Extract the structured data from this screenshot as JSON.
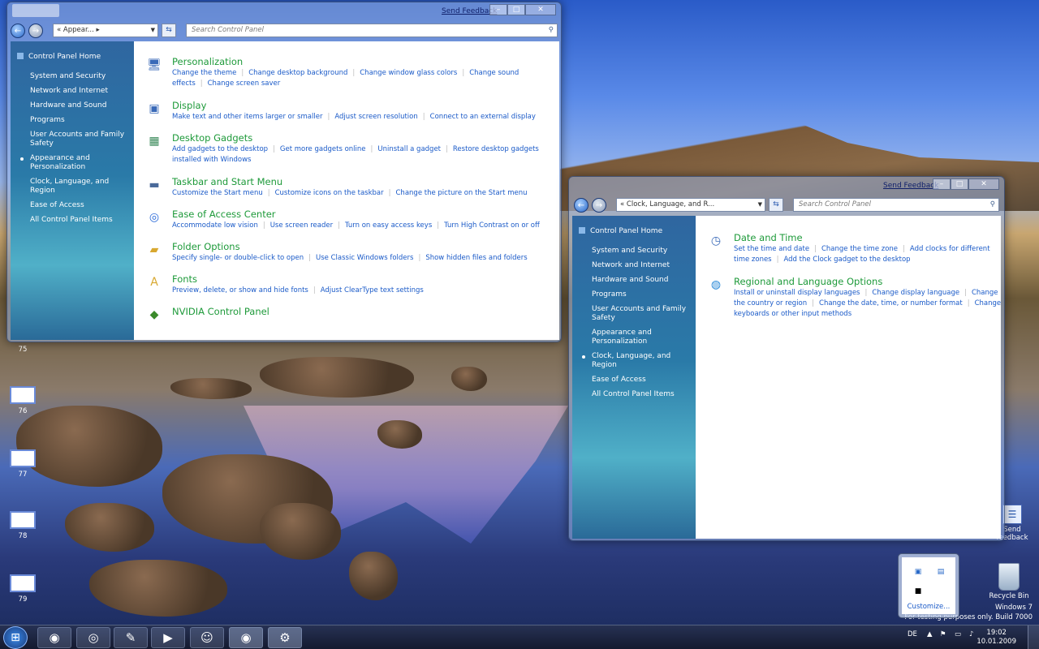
{
  "window_left": {
    "feedback": "Send Feedback",
    "address": "« Appear... ▸",
    "search_placeholder": "Search Control Panel",
    "sidebar": {
      "home": "Control Panel Home",
      "items": [
        {
          "label": "System and Security"
        },
        {
          "label": "Network and Internet"
        },
        {
          "label": "Hardware and Sound"
        },
        {
          "label": "Programs"
        },
        {
          "label": "User Accounts and Family Safety"
        },
        {
          "label": "Appearance and Personalization",
          "active": true
        },
        {
          "label": "Clock, Language, and Region"
        },
        {
          "label": "Ease of Access"
        },
        {
          "label": "All Control Panel Items"
        }
      ]
    },
    "categories": [
      {
        "icon": "personalization-icon",
        "title": "Personalization",
        "links": [
          "Change the theme",
          "Change desktop background",
          "Change window glass colors",
          "Change sound effects",
          "Change screen saver"
        ]
      },
      {
        "icon": "display-icon",
        "title": "Display",
        "links": [
          "Make text and other items larger or smaller",
          "Adjust screen resolution",
          "Connect to an external display"
        ]
      },
      {
        "icon": "desktop-gadgets-icon",
        "title": "Desktop Gadgets",
        "links": [
          "Add gadgets to the desktop",
          "Get more gadgets online",
          "Uninstall a gadget",
          "Restore desktop gadgets installed with Windows"
        ]
      },
      {
        "icon": "taskbar-icon",
        "title": "Taskbar and Start Menu",
        "links": [
          "Customize the Start menu",
          "Customize icons on the taskbar",
          "Change the picture on the Start menu"
        ]
      },
      {
        "icon": "ease-of-access-icon",
        "title": "Ease of Access Center",
        "links": [
          "Accommodate low vision",
          "Use screen reader",
          "Turn on easy access keys",
          "Turn High Contrast on or off"
        ]
      },
      {
        "icon": "folder-options-icon",
        "title": "Folder Options",
        "links": [
          "Specify single- or double-click to open",
          "Use Classic Windows folders",
          "Show hidden files and folders"
        ]
      },
      {
        "icon": "fonts-icon",
        "title": "Fonts",
        "links": [
          "Preview, delete, or show and hide fonts",
          "Adjust ClearType text settings"
        ]
      },
      {
        "icon": "nvidia-icon",
        "title": "NVIDIA Control Panel",
        "links": []
      }
    ]
  },
  "window_right": {
    "feedback": "Send Feedback",
    "address": "« Clock, Language, and R...",
    "search_placeholder": "Search Control Panel",
    "sidebar": {
      "home": "Control Panel Home",
      "items": [
        {
          "label": "System and Security"
        },
        {
          "label": "Network and Internet"
        },
        {
          "label": "Hardware and Sound"
        },
        {
          "label": "Programs"
        },
        {
          "label": "User Accounts and Family Safety"
        },
        {
          "label": "Appearance and Personalization"
        },
        {
          "label": "Clock, Language, and Region",
          "active": true
        },
        {
          "label": "Ease of Access"
        },
        {
          "label": "All Control Panel Items"
        }
      ]
    },
    "categories": [
      {
        "icon": "date-time-icon",
        "title": "Date and Time",
        "links": [
          "Set the time and date",
          "Change the time zone",
          "Add clocks for different time zones",
          "Add the Clock gadget to the desktop"
        ]
      },
      {
        "icon": "globe-icon",
        "title": "Regional and Language Options",
        "links": [
          "Install or uninstall display languages",
          "Change display language",
          "Change the country or region",
          "Change the date, time, or number format",
          "Change keyboards or other input methods"
        ]
      }
    ]
  },
  "desktop": {
    "icons": [
      "75",
      "76",
      "77",
      "78",
      "79"
    ],
    "send_feedback": "Send feedback",
    "recycle_bin": "Recycle Bin",
    "watermark_1": "Windows 7",
    "watermark_2": "For testing purposes only. Build 7000"
  },
  "tray_popup": {
    "customize": "Customize..."
  },
  "taskbar": {
    "language": "DE",
    "time": "19:02",
    "date": "10.01.2009",
    "buttons": [
      "firefox-icon",
      "media-icon",
      "paint-icon",
      "media-player-icon",
      "messenger-icon",
      "firefox-icon",
      "control-panel-icon"
    ]
  }
}
